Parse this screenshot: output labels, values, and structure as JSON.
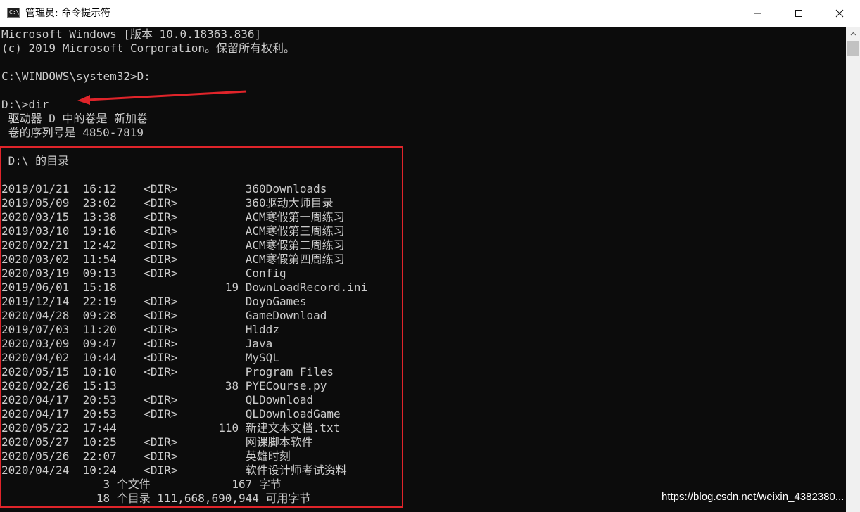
{
  "window": {
    "title": "管理员: 命令提示符",
    "app_icon_text": "C:\\",
    "minimize_icon": "minimize-icon",
    "maximize_icon": "maximize-icon",
    "close_icon": "close-icon"
  },
  "console": {
    "lines": [
      "Microsoft Windows [版本 10.0.18363.836]",
      "(c) 2019 Microsoft Corporation。保留所有权利。",
      "",
      "C:\\WINDOWS\\system32>D:",
      "",
      "D:\\>dir",
      " 驱动器 D 中的卷是 新加卷",
      " 卷的序列号是 4850-7819",
      "",
      " D:\\ 的目录",
      "",
      "2019/01/21  16:12    <DIR>          360Downloads",
      "2019/05/09  23:02    <DIR>          360驱动大师目录",
      "2020/03/15  13:38    <DIR>          ACM寒假第一周练习",
      "2019/03/10  19:16    <DIR>          ACM寒假第三周练习",
      "2020/02/21  12:42    <DIR>          ACM寒假第二周练习",
      "2020/03/02  11:54    <DIR>          ACM寒假第四周练习",
      "2020/03/19  09:13    <DIR>          Config",
      "2019/06/01  15:18                19 DownLoadRecord.ini",
      "2019/12/14  22:19    <DIR>          DoyoGames",
      "2020/04/28  09:28    <DIR>          GameDownload",
      "2019/07/03  11:20    <DIR>          Hlddz",
      "2020/03/09  09:47    <DIR>          Java",
      "2020/04/02  10:44    <DIR>          MySQL",
      "2020/05/15  10:10    <DIR>          Program Files",
      "2020/02/26  15:13                38 PYECourse.py",
      "2020/04/17  20:53    <DIR>          QLDownload",
      "2020/04/17  20:53    <DIR>          QLDownloadGame",
      "2020/05/22  17:44               110 新建文本文档.txt",
      "2020/05/27  10:25    <DIR>          网课脚本软件",
      "2020/05/26  22:07    <DIR>          英雄时刻",
      "2020/04/24  10:24    <DIR>          软件设计师考试资料",
      "               3 个文件            167 字节",
      "              18 个目录 111,668,690,944 可用字节"
    ]
  },
  "annotations": {
    "arrow_color": "#e0242a",
    "box_color": "#e0242a"
  },
  "watermark": "https://blog.csdn.net/weixin_4382380..."
}
